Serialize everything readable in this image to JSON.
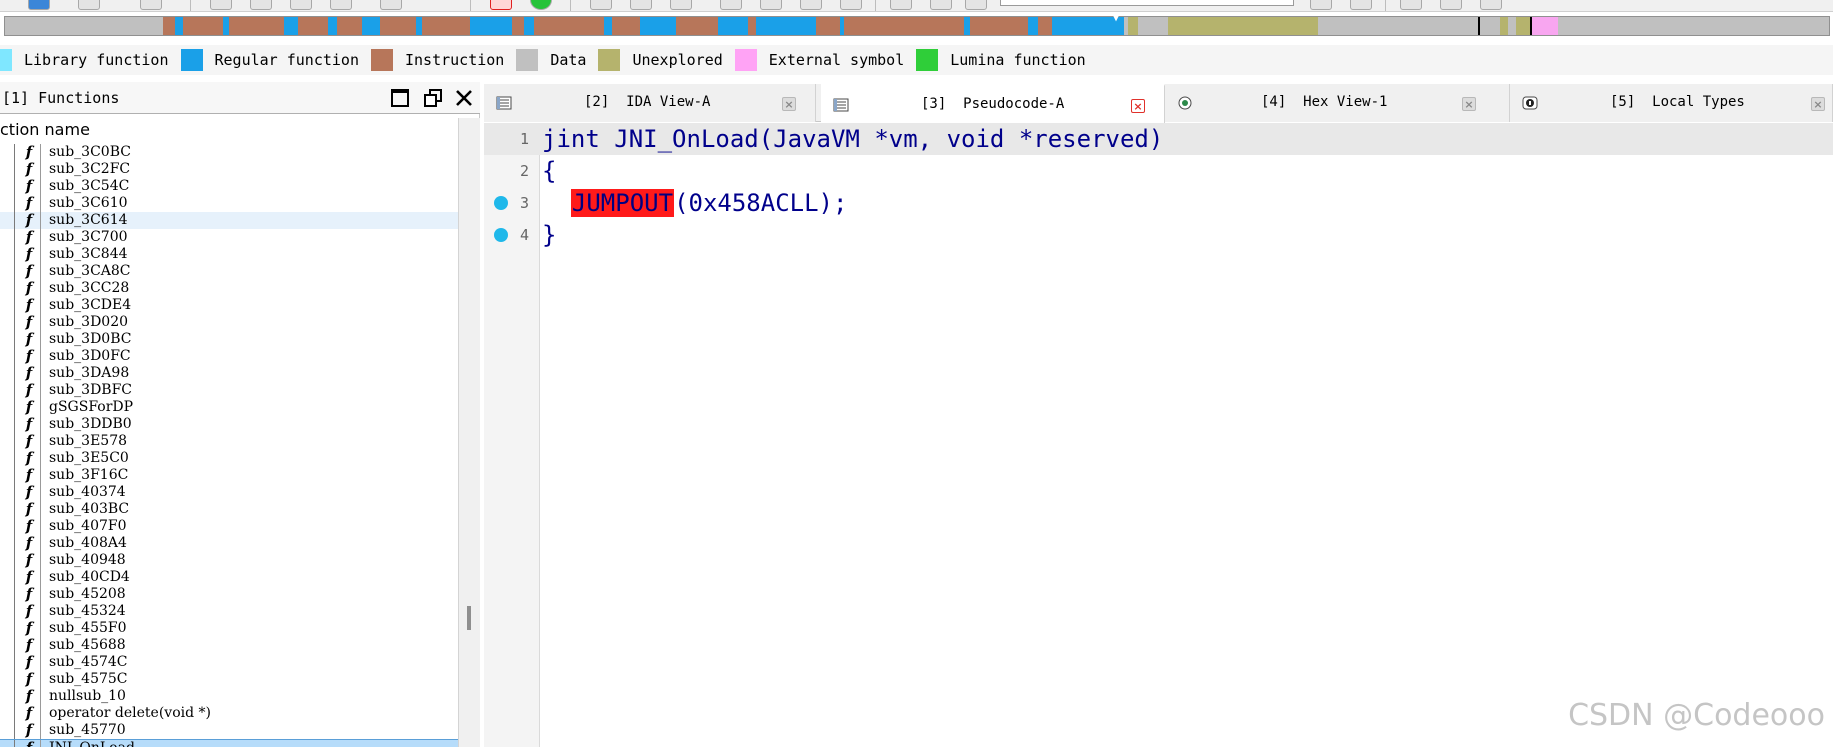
{
  "navband": {
    "segments": [
      {
        "color": "#c0c0c0",
        "w": 158
      },
      {
        "color": "#b7765a",
        "w": 12
      },
      {
        "color": "#1aa0e8",
        "w": 8
      },
      {
        "color": "#b7765a",
        "w": 40
      },
      {
        "color": "#1aa0e8",
        "w": 6
      },
      {
        "color": "#b7765a",
        "w": 55
      },
      {
        "color": "#1aa0e8",
        "w": 14
      },
      {
        "color": "#b7765a",
        "w": 30
      },
      {
        "color": "#1aa0e8",
        "w": 9
      },
      {
        "color": "#b7765a",
        "w": 25
      },
      {
        "color": "#1aa0e8",
        "w": 18
      },
      {
        "color": "#b7765a",
        "w": 36
      },
      {
        "color": "#1aa0e8",
        "w": 6
      },
      {
        "color": "#b7765a",
        "w": 48
      },
      {
        "color": "#1aa0e8",
        "w": 42
      },
      {
        "color": "#b7765a",
        "w": 12
      },
      {
        "color": "#1aa0e8",
        "w": 10
      },
      {
        "color": "#b7765a",
        "w": 70
      },
      {
        "color": "#1aa0e8",
        "w": 8
      },
      {
        "color": "#b7765a",
        "w": 28
      },
      {
        "color": "#1aa0e8",
        "w": 36
      },
      {
        "color": "#b7765a",
        "w": 42
      },
      {
        "color": "#1aa0e8",
        "w": 30
      },
      {
        "color": "#b7765a",
        "w": 8
      },
      {
        "color": "#1aa0e8",
        "w": 60
      },
      {
        "color": "#b7765a",
        "w": 24
      },
      {
        "color": "#1aa0e8",
        "w": 4
      },
      {
        "color": "#b7765a",
        "w": 120
      },
      {
        "color": "#1aa0e8",
        "w": 6
      },
      {
        "color": "#b7765a",
        "w": 58
      },
      {
        "color": "#1aa0e8",
        "w": 10
      },
      {
        "color": "#b7765a",
        "w": 14
      },
      {
        "color": "#1aa0e8",
        "w": 72
      },
      {
        "color": "#c0c0c0",
        "w": 4
      },
      {
        "color": "#b5b36d",
        "w": 10
      },
      {
        "color": "#c0c0c0",
        "w": 30
      },
      {
        "color": "#b5b36d",
        "w": 150
      },
      {
        "color": "#c0c0c0",
        "w": 160
      },
      {
        "color": "#000000",
        "w": 2
      },
      {
        "color": "#c0c0c0",
        "w": 20
      },
      {
        "color": "#b5b36d",
        "w": 8
      },
      {
        "color": "#c0c0c0",
        "w": 8
      },
      {
        "color": "#b5b36d",
        "w": 14
      },
      {
        "color": "#000000",
        "w": 2
      },
      {
        "color": "#f8a6f0",
        "w": 26
      }
    ]
  },
  "legend": {
    "items": [
      {
        "label": "Library function",
        "color": "#7fe7ff"
      },
      {
        "label": "Regular function",
        "color": "#1aa0e8"
      },
      {
        "label": "Instruction",
        "color": "#b7765a"
      },
      {
        "label": "Data",
        "color": "#c0c0c0"
      },
      {
        "label": "Unexplored",
        "color": "#b5b36d"
      },
      {
        "label": "External symbol",
        "color": "#ffa3f5"
      },
      {
        "label": "Lumina function",
        "color": "#2fce39"
      }
    ]
  },
  "functions_panel": {
    "title": "[1]  Functions",
    "column_header": "ction name",
    "items": [
      "sub_3C0BC",
      "sub_3C2FC",
      "sub_3C54C",
      "sub_3C610",
      "sub_3C614",
      "sub_3C700",
      "sub_3C844",
      "sub_3CA8C",
      "sub_3CC28",
      "sub_3CDE4",
      "sub_3D020",
      "sub_3D0BC",
      "sub_3D0FC",
      "sub_3DA98",
      "sub_3DBFC",
      "gSGSForDP",
      "sub_3DDB0",
      "sub_3E578",
      "sub_3E5C0",
      "sub_3F16C",
      "sub_40374",
      "sub_403BC",
      "sub_407F0",
      "sub_408A4",
      "sub_40948",
      "sub_40CD4",
      "sub_45208",
      "sub_45324",
      "sub_455F0",
      "sub_45688",
      "sub_4574C",
      "sub_4575C",
      "nullsub_10",
      "operator delete(void *)",
      "sub_45770",
      "JNI_OnLoad"
    ],
    "selected_index": 4,
    "current_index": 35
  },
  "tabs": [
    {
      "label": "[2]  IDA View-A",
      "active": false
    },
    {
      "label": "[3]  Pseudocode-A",
      "active": true
    },
    {
      "label": "[4]  Hex View-1",
      "active": false
    },
    {
      "label": "[5]  Local Types",
      "active": false
    }
  ],
  "code": {
    "lines": [
      {
        "num": "1",
        "text": "jint JNI_OnLoad(JavaVM *vm, void *reserved)",
        "breakpoint": false
      },
      {
        "num": "2",
        "text": "{",
        "breakpoint": false
      },
      {
        "num": "3",
        "pre": "  ",
        "error_token": "JUMPOUT",
        "post": "(0x458ACLL);",
        "breakpoint": true
      },
      {
        "num": "4",
        "text": "}",
        "breakpoint": true
      }
    ]
  },
  "watermark": "CSDN @Codeooo"
}
